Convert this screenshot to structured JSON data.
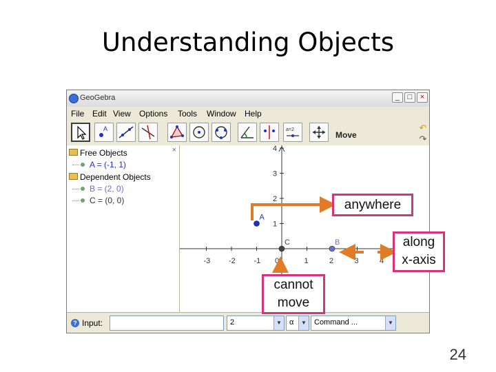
{
  "slide": {
    "title": "Understanding Objects",
    "page_number": "24"
  },
  "window": {
    "title": "GeoGebra",
    "controls": [
      "_",
      "□",
      "×"
    ],
    "menu": [
      "File",
      "Edit",
      "View",
      "Options",
      "Tools",
      "Window",
      "Help"
    ],
    "toolbar": {
      "tools": [
        "move-tool",
        "point-tool",
        "line-tool",
        "perpendicular-tool",
        "polygon-tool",
        "circle-tool",
        "conic-tool",
        "angle-tool",
        "reflect-tool",
        "slider-tool",
        "move-view-tool"
      ],
      "point_tool_label": "A",
      "slider_tool_label": "a=2",
      "current_mode": "Move"
    },
    "algebra_view": {
      "close": "×",
      "free_objects_label": "Free Objects",
      "free_objects": [
        "A = (-1, 1)"
      ],
      "dependent_objects_label": "Dependent Objects",
      "dependent_objects": [
        "B = (2, 0)",
        "C = (0, 0)"
      ]
    },
    "graphics_view": {
      "x_ticks": [
        "-3",
        "-2",
        "-1",
        "0",
        "1",
        "2",
        "3",
        "4"
      ],
      "y_ticks": [
        "4",
        "3",
        "2",
        "1"
      ],
      "points": [
        {
          "label": "A",
          "x": -1,
          "y": 1,
          "color": "#1a2fd6"
        },
        {
          "label": "B",
          "x": 2,
          "y": 0,
          "color": "#6a70d0"
        },
        {
          "label": "C",
          "x": 0,
          "y": 0,
          "color": "#444444"
        }
      ]
    },
    "input_bar": {
      "label": "Input:",
      "value": "",
      "number_combo": "2",
      "symbol_combo": "α",
      "command_combo": "Command ..."
    }
  },
  "annotations": {
    "anywhere": "anywhere",
    "along_line1": "along",
    "along_line2": "x-axis",
    "cannot_line1": "cannot",
    "cannot_line2": "move",
    "arrow_color": "#e07b28",
    "border_color": "#d8337a"
  }
}
